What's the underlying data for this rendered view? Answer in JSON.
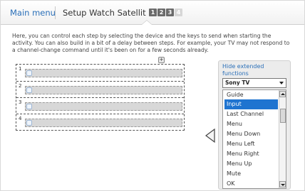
{
  "header": {
    "main_menu": "Main menu",
    "title": "Setup Watch Satellit",
    "steps": [
      "1",
      "2",
      "3",
      "4"
    ],
    "active_steps": 3
  },
  "description": "Here, you can control each step by selecting the device and the keys to send when starting the activity. You can also build in a bit of a delay between steps. For example, your TV may not respond to a channel-change command until it's been on for a few seconds already.",
  "steps_list": {
    "add_label": "+",
    "rows": [
      {
        "number": "1"
      },
      {
        "number": "2"
      },
      {
        "number": "3"
      },
      {
        "number": "4"
      }
    ]
  },
  "panel": {
    "hide_link": "Hide extended functions",
    "device": "Sony TV",
    "keys": [
      "Guide",
      "Input",
      "Last Channel",
      "Menu",
      "Menu Down",
      "Menu Left",
      "Menu Right",
      "Menu Up",
      "Mute",
      "OK"
    ],
    "selected_key": "Input"
  },
  "colors": {
    "accent": "#2a6fb8",
    "selected": "#1f74d0"
  },
  "icons": {
    "add": "plus-icon",
    "arrow": "left-arrow-icon",
    "dropdown": "chevron-down-icon",
    "drag": "drag-handle-icon"
  }
}
